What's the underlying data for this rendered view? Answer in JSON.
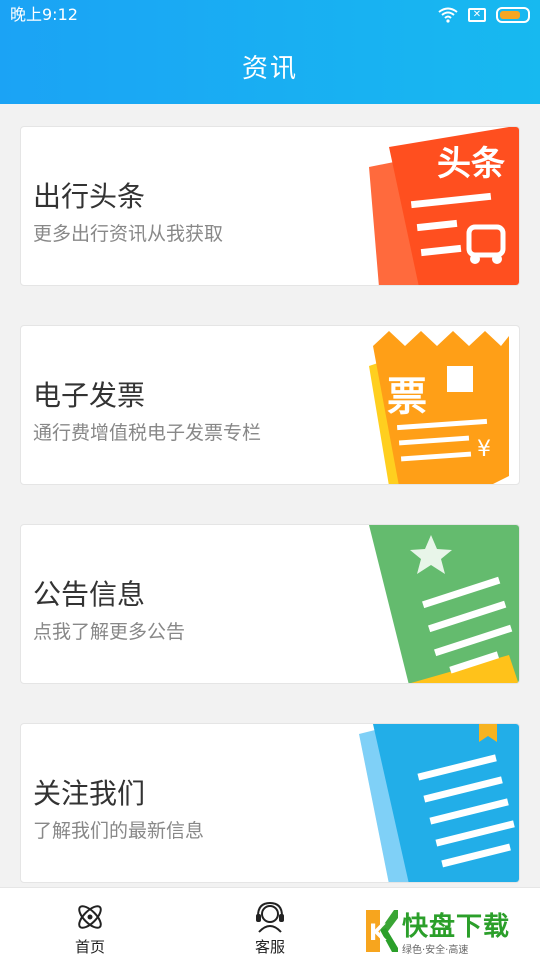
{
  "status_bar": {
    "time": "晚上9:12"
  },
  "header": {
    "title": "资讯"
  },
  "cards": [
    {
      "title": "出行头条",
      "subtitle": "更多出行资讯从我获取",
      "art_text": "头条"
    },
    {
      "title": "电子发票",
      "subtitle": "通行费增值税电子发票专栏",
      "art_text": "票"
    },
    {
      "title": "公告信息",
      "subtitle": "点我了解更多公告"
    },
    {
      "title": "关注我们",
      "subtitle": "了解我们的最新信息"
    }
  ],
  "tabs": [
    {
      "label": "首页",
      "icon": "atom-icon"
    },
    {
      "label": "客服",
      "icon": "headset-icon"
    }
  ],
  "watermark": {
    "big": "快盘下载",
    "sub": "绿色·安全·高速",
    "letter": "K"
  },
  "colors": {
    "header_start": "#1ba3f5",
    "header_end": "#17b9f0"
  }
}
